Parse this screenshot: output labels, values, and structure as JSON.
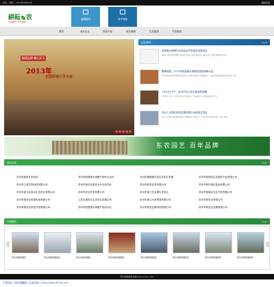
{
  "topbar": {
    "left": "您好，游客！ 2015年08月18日",
    "right": "服务反馈"
  },
  "brand": {
    "name": "耕耘",
    "name2": "农",
    "slogan": "东农园艺  百年品牌"
  },
  "nav_buttons": [
    {
      "label": "苗圃首页"
    },
    {
      "label": "电子商务"
    }
  ],
  "menu": [
    "首页",
    "龙头企业",
    "特色产品",
    "地方新闻",
    "生态旅游",
    "产品商城"
  ],
  "banner": {
    "tag": "丽德品牌 畅行天下",
    "year": "2013年",
    "subtitle": "全国经销订货大会",
    "pages": [
      "1",
      "2",
      "3",
      "4",
      "5"
    ]
  },
  "news": {
    "title": "企业资讯",
    "more": "more",
    "items": [
      {
        "title": "阳澄湖大闸蟹行业协会召开年度总结座谈会",
        "desc": "本报讯 阳澄湖大闸蟹行业协会日前召开年度总结会，总结全年工作并部署来年计划。"
      },
      {
        "title": "蟹满秋园，2013年阳澄湖大闸蟹全国经销商大会",
        "desc": "2013年阳澄湖大闸蟹全国经销订货大会日前在苏州隆重举行，来自全国各地的经销商齐聚一堂。"
      },
      {
        "title": "7月10日下午，苏州市农业农村局领导视察",
        "desc": "7月10日下午，苏州市农业农村局领导一行来到公司实地调研指导工作。"
      },
      {
        "title": "苏州工业园区科技发展有限公司参观交流会",
        "desc": "苏州工业园区科技发展有限公司组织员工参观学习，双方就合作事宜进行了深入交流。"
      }
    ]
  },
  "green_banner": {
    "text": "东农园艺  百年品牌"
  },
  "companies_section": {
    "title": "龙头企业",
    "more": "more"
  },
  "companies": [
    [
      "苏州市新奇艺农科技",
      "苏州市阳澄湖大闸蟹产销专业合作",
      "苏州阳澄湖莲花岛生态农业发展",
      "苏州市新绿优生态园农产品有限公司"
    ],
    [
      "苏州市江城生物科技有限公司",
      "苏州市吴中区新农业专业合作社",
      "苏州市新农业农有限公司",
      "苏州市新华绿化苗木有限公司"
    ],
    [
      "苏州市吴江区苗木生态农业有限公司",
      "苏州市农业开发有限公司",
      "苏州市吴江东太湖生态农业",
      "苏州市相城区农业开发有限公司"
    ],
    [
      "苏州市新农业种苗科技有限公司",
      "江苏太湖农业生态农业发展公司",
      "苏州市吴江大米贸易有限公司",
      "苏州市新农业有限公司"
    ],
    [
      "苏州市新农业科技开发有限公司",
      "苏州市阳澄湖大闸蟹产销合作社",
      "苏州市新农业新科技有限公司",
      "苏州市新农业发展有限公司"
    ]
  ],
  "gallery_section": {
    "title": "产品展示",
    "more": "more"
  },
  "gallery": [
    "苏州市阳澄湖东",
    "苏州市阳澄湖观光",
    "苏州市阳澄湖园",
    "苏州市阳澄湖观光",
    "苏州市阳澄湖观光",
    "苏州市阳澄湖观光",
    "苏州市阳澄湖观光",
    "苏州市阳澄湖观光"
  ],
  "footer": {
    "text": "苏州市科技农业网   www.sznyv.com"
  },
  "status": {
    "text": "卡昆农业 | 纳尔耕圆圃 | 生态|网站 | http://www.3Pusk.com"
  }
}
